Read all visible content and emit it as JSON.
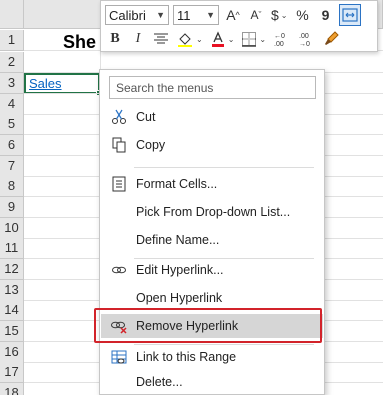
{
  "sheet": {
    "rows": [
      "1",
      "2",
      "3",
      "4",
      "5",
      "6",
      "7",
      "8",
      "9",
      "10",
      "11",
      "12",
      "13",
      "14",
      "15",
      "16",
      "17",
      "18"
    ],
    "title_text": "She",
    "link_cell_text": "Sales"
  },
  "toolbar": {
    "font_name": "Calibri",
    "font_size": "11",
    "grow_font": "A",
    "shrink_font": "A",
    "currency": "$",
    "percent": "%",
    "comma": "9",
    "bold": "B",
    "italic": "I"
  },
  "menu": {
    "search_placeholder": "Search the menus",
    "items": [
      {
        "label": "Cut",
        "icon": "scissors-icon"
      },
      {
        "label": "Copy",
        "icon": "copy-icon"
      },
      {
        "label": "Format Cells...",
        "icon": "format-cells-icon"
      },
      {
        "label": "Pick From Drop-down List...",
        "icon": ""
      },
      {
        "label": "Define Name...",
        "icon": ""
      },
      {
        "label": "Edit Hyperlink...",
        "icon": "edit-hyperlink-icon"
      },
      {
        "label": "Open Hyperlink",
        "icon": ""
      },
      {
        "label": "Remove Hyperlink",
        "icon": "remove-hyperlink-icon"
      },
      {
        "label": "Link to this Range",
        "icon": "link-range-icon"
      },
      {
        "label": "Delete...",
        "icon": ""
      }
    ]
  },
  "colors": {
    "highlight_outline": "#d2232a",
    "hover_bg": "#d6d6d6",
    "link_blue": "#0563c1",
    "selection_green": "#217346",
    "font_color_red": "#e81123"
  }
}
